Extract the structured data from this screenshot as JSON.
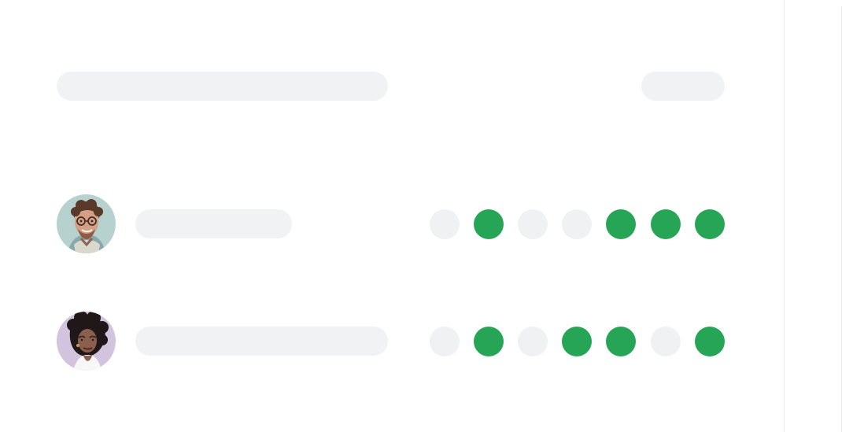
{
  "colors": {
    "background": "#ffffff",
    "skeleton": "#f1f2f4",
    "dot_off": "#f0f1f3",
    "dot_on": "#27a556",
    "divider": "#eaebed"
  },
  "rows": [
    {
      "avatar": "avatar-man-glasses",
      "dots": [
        false,
        true,
        false,
        false,
        true,
        true,
        true
      ]
    },
    {
      "avatar": "avatar-woman-curly-hair",
      "dots": [
        false,
        true,
        false,
        true,
        true,
        false,
        true
      ]
    }
  ]
}
